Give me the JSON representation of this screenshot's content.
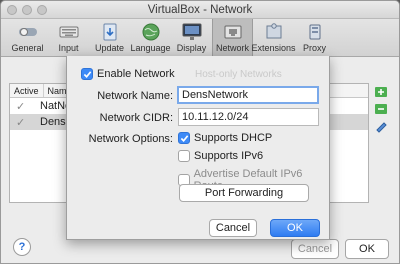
{
  "window": {
    "title": "VirtualBox - Network"
  },
  "toolbar": {
    "items": [
      {
        "label": "General",
        "icon": "switch-icon"
      },
      {
        "label": "Input",
        "icon": "keyboard-icon"
      },
      {
        "label": "Update",
        "icon": "update-icon"
      },
      {
        "label": "Language",
        "icon": "globe-icon"
      },
      {
        "label": "Display",
        "icon": "monitor-icon"
      },
      {
        "label": "Network",
        "icon": "network-icon",
        "selected": true
      },
      {
        "label": "Extensions",
        "icon": "puzzle-icon"
      },
      {
        "label": "Proxy",
        "icon": "proxy-icon"
      }
    ]
  },
  "list": {
    "headers": [
      "Active",
      "Name"
    ],
    "rows": [
      {
        "active": "✓",
        "name": "NatNetwork"
      },
      {
        "active": "✓",
        "name": "DensNetwork",
        "selected": true
      }
    ],
    "ghost_tab": "Host-only Networks"
  },
  "footer": {
    "help": "?",
    "cancel": "Cancel",
    "ok": "OK"
  },
  "dialog": {
    "enable_label": "Enable Network",
    "enable_checked": true,
    "name_label": "Network Name:",
    "name_value": "DensNetwork",
    "cidr_label": "Network CIDR:",
    "cidr_value": "10.11.12.0/24",
    "options_label": "Network Options:",
    "dhcp_label": "Supports DHCP",
    "dhcp_checked": true,
    "ipv6_label": "Supports IPv6",
    "ipv6_checked": false,
    "route_label": "Advertise Default IPv6 Route",
    "route_checked": false,
    "port_forwarding": "Port Forwarding",
    "cancel": "Cancel",
    "ok": "OK"
  },
  "colors": {
    "accent": "#3d8af7",
    "selection": "#d6d6d6"
  }
}
